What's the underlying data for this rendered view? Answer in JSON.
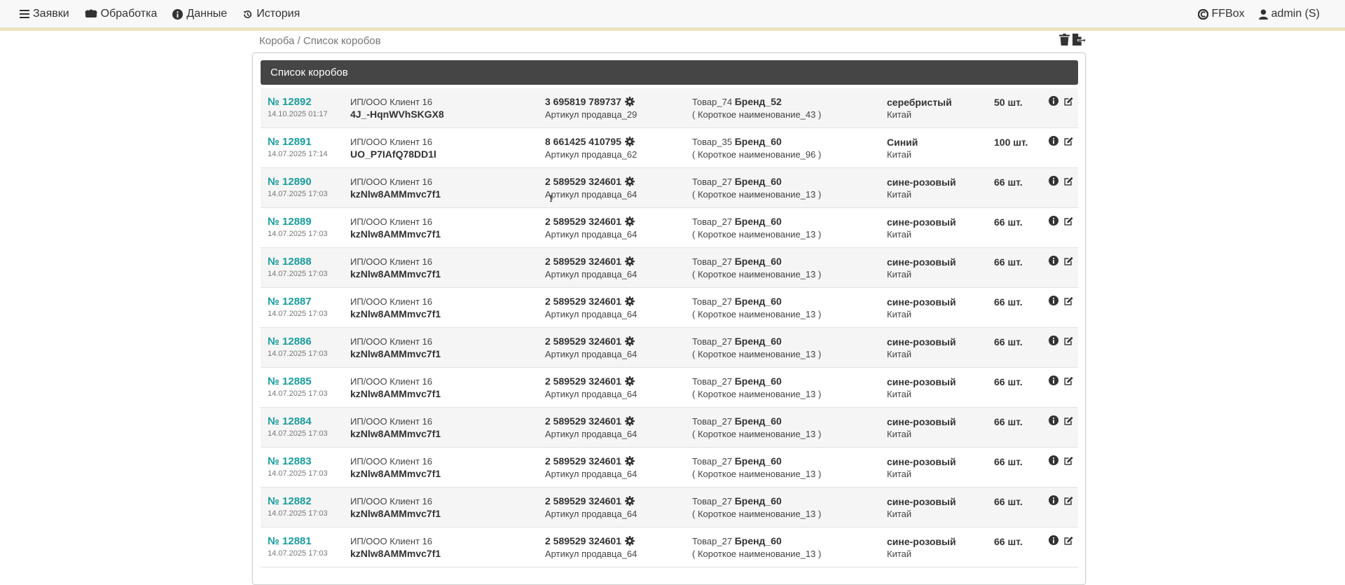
{
  "navbar": {
    "left": [
      {
        "label": "Заявки",
        "icon": "menu-icon"
      },
      {
        "label": "Обработка",
        "icon": "cogs-icon"
      },
      {
        "label": "Данные",
        "icon": "info-icon"
      },
      {
        "label": "История",
        "icon": "history-icon"
      }
    ],
    "brand": {
      "label": "FFBox",
      "icon": "brand-logo-icon"
    },
    "user": {
      "label": "admin (S)",
      "icon": "user-icon"
    }
  },
  "breadcrumb": {
    "parent": "Короба",
    "separator": " / ",
    "current": "Список коробов"
  },
  "top_actions": [
    {
      "icon": "trash-icon"
    },
    {
      "icon": "file-export-icon"
    }
  ],
  "panel": {
    "title": "Список коробов"
  },
  "colors": {
    "accent": "#1a9c9c",
    "header_bg": "#454545",
    "accent_line": "#efe3b8"
  },
  "boxes": [
    {
      "num": "№ 12892",
      "date": "14.10.2025 01:17",
      "client": "ИП/ООО Клиент 16",
      "code": "4J_-HqnWVhSKGX8",
      "barcode": "3 695819 789737",
      "article": "Артикул продавца_29",
      "product": "Товар_74",
      "brand": "Бренд_52",
      "short": "( Короткое наименование_43 )",
      "color": "серебристый",
      "country": "Китай",
      "qty": "50 шт."
    },
    {
      "num": "№ 12891",
      "date": "14.07.2025 17:14",
      "client": "ИП/ООО Клиент 16",
      "code": "UO_P7IAfQ78DD1l",
      "barcode": "8 661425 410795",
      "article": "Артикул продавца_62",
      "product": "Товар_35",
      "brand": "Бренд_60",
      "short": "( Короткое наименование_96 )",
      "color": "Синий",
      "country": "Китай",
      "qty": "100 шт."
    },
    {
      "num": "№ 12890",
      "date": "14.07.2025 17:03",
      "client": "ИП/ООО Клиент 16",
      "code": "kzNlw8AMMmvc7f1",
      "barcode": "2 589529 324601",
      "article": "Артикул продавца_64",
      "product": "Товар_27",
      "brand": "Бренд_60",
      "short": "( Короткое наименование_13 )",
      "color": "сине-розовый",
      "country": "Китай",
      "qty": "66 шт."
    },
    {
      "num": "№ 12889",
      "date": "14.07.2025 17:03",
      "client": "ИП/ООО Клиент 16",
      "code": "kzNlw8AMMmvc7f1",
      "barcode": "2 589529 324601",
      "article": "Артикул продавца_64",
      "product": "Товар_27",
      "brand": "Бренд_60",
      "short": "( Короткое наименование_13 )",
      "color": "сине-розовый",
      "country": "Китай",
      "qty": "66 шт."
    },
    {
      "num": "№ 12888",
      "date": "14.07.2025 17:03",
      "client": "ИП/ООО Клиент 16",
      "code": "kzNlw8AMMmvc7f1",
      "barcode": "2 589529 324601",
      "article": "Артикул продавца_64",
      "product": "Товар_27",
      "brand": "Бренд_60",
      "short": "( Короткое наименование_13 )",
      "color": "сине-розовый",
      "country": "Китай",
      "qty": "66 шт."
    },
    {
      "num": "№ 12887",
      "date": "14.07.2025 17:03",
      "client": "ИП/ООО Клиент 16",
      "code": "kzNlw8AMMmvc7f1",
      "barcode": "2 589529 324601",
      "article": "Артикул продавца_64",
      "product": "Товар_27",
      "brand": "Бренд_60",
      "short": "( Короткое наименование_13 )",
      "color": "сине-розовый",
      "country": "Китай",
      "qty": "66 шт."
    },
    {
      "num": "№ 12886",
      "date": "14.07.2025 17:03",
      "client": "ИП/ООО Клиент 16",
      "code": "kzNlw8AMMmvc7f1",
      "barcode": "2 589529 324601",
      "article": "Артикул продавца_64",
      "product": "Товар_27",
      "brand": "Бренд_60",
      "short": "( Короткое наименование_13 )",
      "color": "сине-розовый",
      "country": "Китай",
      "qty": "66 шт."
    },
    {
      "num": "№ 12885",
      "date": "14.07.2025 17:03",
      "client": "ИП/ООО Клиент 16",
      "code": "kzNlw8AMMmvc7f1",
      "barcode": "2 589529 324601",
      "article": "Артикул продавца_64",
      "product": "Товар_27",
      "brand": "Бренд_60",
      "short": "( Короткое наименование_13 )",
      "color": "сине-розовый",
      "country": "Китай",
      "qty": "66 шт."
    },
    {
      "num": "№ 12884",
      "date": "14.07.2025 17:03",
      "client": "ИП/ООО Клиент 16",
      "code": "kzNlw8AMMmvc7f1",
      "barcode": "2 589529 324601",
      "article": "Артикул продавца_64",
      "product": "Товар_27",
      "brand": "Бренд_60",
      "short": "( Короткое наименование_13 )",
      "color": "сине-розовый",
      "country": "Китай",
      "qty": "66 шт."
    },
    {
      "num": "№ 12883",
      "date": "14.07.2025 17:03",
      "client": "ИП/ООО Клиент 16",
      "code": "kzNlw8AMMmvc7f1",
      "barcode": "2 589529 324601",
      "article": "Артикул продавца_64",
      "product": "Товар_27",
      "brand": "Бренд_60",
      "short": "( Короткое наименование_13 )",
      "color": "сине-розовый",
      "country": "Китай",
      "qty": "66 шт."
    },
    {
      "num": "№ 12882",
      "date": "14.07.2025 17:03",
      "client": "ИП/ООО Клиент 16",
      "code": "kzNlw8AMMmvc7f1",
      "barcode": "2 589529 324601",
      "article": "Артикул продавца_64",
      "product": "Товар_27",
      "brand": "Бренд_60",
      "short": "( Короткое наименование_13 )",
      "color": "сине-розовый",
      "country": "Китай",
      "qty": "66 шт."
    },
    {
      "num": "№ 12881",
      "date": "14.07.2025 17:03",
      "client": "ИП/ООО Клиент 16",
      "code": "kzNlw8AMMmvc7f1",
      "barcode": "2 589529 324601",
      "article": "Артикул продавца_64",
      "product": "Товар_27",
      "brand": "Бренд_60",
      "short": "( Короткое наименование_13 )",
      "color": "сине-розовый",
      "country": "Китай",
      "qty": "66 шт."
    }
  ]
}
